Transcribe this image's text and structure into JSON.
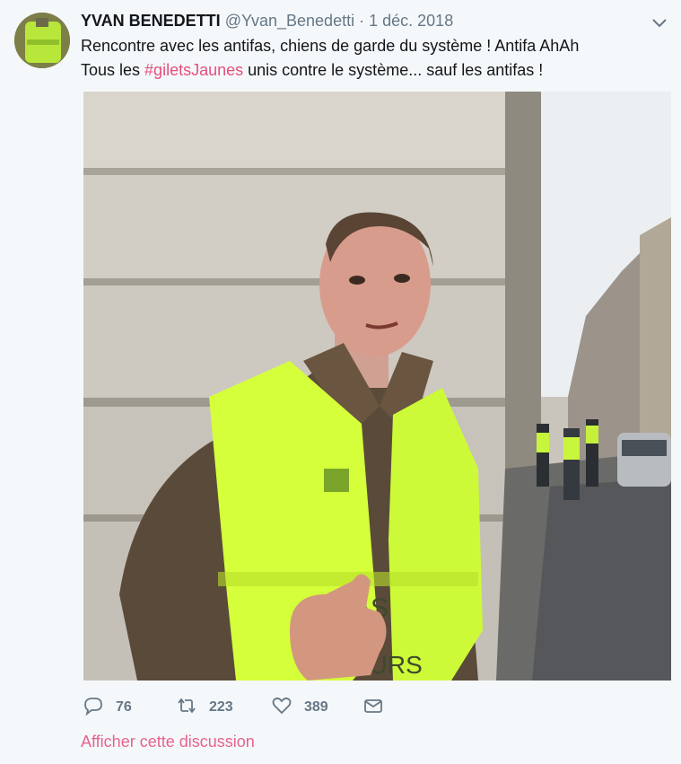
{
  "tweet": {
    "author_name": "YVAN BENEDETTI",
    "author_handle": "@Yvan_Benedetti",
    "separator": "·",
    "date": "1 déc. 2018",
    "line1": "Rencontre avec les antifas, chiens de garde du système ! Antifa AhAh",
    "line2_prefix": "Tous les ",
    "hashtag": "#giletsJaunes",
    "line2_suffix": " unis contre le système... sauf les antifas !",
    "vest_text_1": "BAS",
    "vest_text_2": "EURS"
  },
  "actions": {
    "reply_count": "76",
    "retweet_count": "223",
    "like_count": "389"
  },
  "show_thread_label": "Afficher cette discussion",
  "icons": {
    "reply": "reply-icon",
    "retweet": "retweet-icon",
    "like": "heart-icon",
    "dm": "envelope-icon",
    "more": "chevron-down-icon"
  },
  "colors": {
    "background": "#f5f8fa",
    "accent": "#e0245e",
    "muted": "#657786",
    "vest": "#d4ff3a"
  }
}
